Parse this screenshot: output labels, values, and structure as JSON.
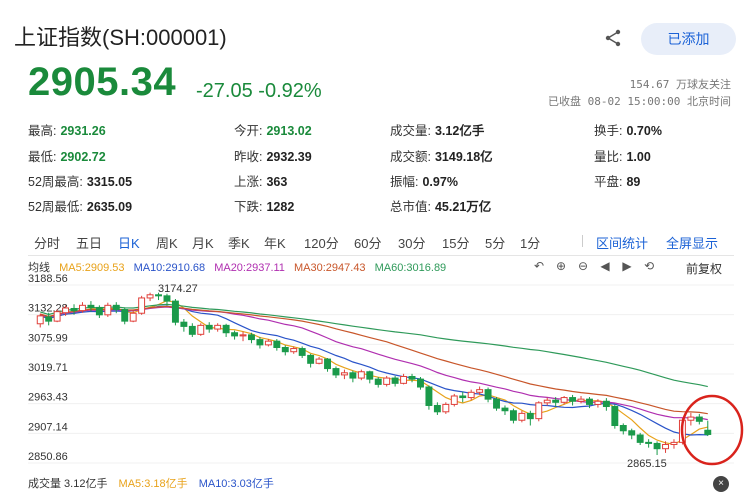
{
  "header": {
    "title": "上证指数(SH:000001)",
    "add_label": "已添加",
    "share_icon": "share-icon"
  },
  "price": {
    "current": "2905.34",
    "change": "-27.05",
    "change_pct": "-0.92%",
    "followers": "154.67 万球友关注",
    "status": "已收盘 08-02 15:00:00 北京时间"
  },
  "quotes": {
    "high_label": "最高:",
    "high": "2931.26",
    "low_label": "最低:",
    "low": "2902.72",
    "wk52_high_label": "52周最高:",
    "wk52_high": "3315.05",
    "wk52_low_label": "52周最低:",
    "wk52_low": "2635.09",
    "open_label": "今开:",
    "open": "2913.02",
    "prev_close_label": "昨收:",
    "prev_close": "2932.39",
    "up_label": "上涨:",
    "up": "363",
    "down_label": "下跌:",
    "down": "1282",
    "volume_label": "成交量:",
    "volume": "3.12亿手",
    "turnover_label": "成交额:",
    "turnover": "3149.18亿",
    "amplitude_label": "振幅:",
    "amplitude": "0.97%",
    "mcap_label": "总市值:",
    "mcap": "45.21万亿",
    "turnover_rate_label": "换手:",
    "turnover_rate": "0.70%",
    "vol_ratio_label": "量比:",
    "vol_ratio": "1.00",
    "flat_label": "平盘:",
    "flat": "89"
  },
  "tabs": {
    "items": [
      "分时",
      "五日",
      "日K",
      "周K",
      "月K",
      "季K",
      "年K",
      "120分",
      "60分",
      "30分",
      "15分",
      "5分",
      "1分"
    ],
    "active": "日K",
    "interval_stats": "区间统计",
    "fullscreen": "全屏显示"
  },
  "ma": {
    "label": "均线",
    "ma5": "MA5:2909.53",
    "ma10": "MA10:2910.68",
    "ma20": "MA20:2937.11",
    "ma30": "MA30:2947.43",
    "ma60": "MA60:3016.89",
    "adjust": "前复权",
    "colors": {
      "ma5": "#e8a21a",
      "ma10": "#2a54c9",
      "ma20": "#b02fb0",
      "ma30": "#c8562a",
      "ma60": "#2f9a5a"
    }
  },
  "chart_icons": [
    "undo-icon",
    "zoom-in-icon",
    "zoom-out-icon",
    "prev-icon",
    "next-icon",
    "reset-icon"
  ],
  "chart_data": {
    "type": "candlestick",
    "y_ticks": [
      "3188.56",
      "3132.28",
      "3075.99",
      "3019.71",
      "2963.43",
      "2907.14",
      "2850.86"
    ],
    "ylim": [
      2850.86,
      3188.56
    ],
    "max_label": "3174.27",
    "min_label": "2865.15",
    "candles": [
      [
        3115,
        3130,
        3108,
        3134
      ],
      [
        3128,
        3120,
        3112,
        3136
      ],
      [
        3120,
        3138,
        3118,
        3142
      ],
      [
        3136,
        3145,
        3130,
        3150
      ],
      [
        3144,
        3140,
        3132,
        3152
      ],
      [
        3140,
        3150,
        3136,
        3156
      ],
      [
        3150,
        3146,
        3138,
        3158
      ],
      [
        3146,
        3132,
        3126,
        3150
      ],
      [
        3132,
        3150,
        3128,
        3155
      ],
      [
        3150,
        3142,
        3135,
        3156
      ],
      [
        3142,
        3120,
        3114,
        3146
      ],
      [
        3120,
        3135,
        3118,
        3140
      ],
      [
        3135,
        3164,
        3132,
        3168
      ],
      [
        3164,
        3170,
        3158,
        3174
      ],
      [
        3170,
        3168,
        3160,
        3174
      ],
      [
        3168,
        3158,
        3150,
        3172
      ],
      [
        3158,
        3118,
        3112,
        3162
      ],
      [
        3118,
        3110,
        3100,
        3124
      ],
      [
        3110,
        3095,
        3090,
        3116
      ],
      [
        3095,
        3112,
        3092,
        3116
      ],
      [
        3112,
        3105,
        3098,
        3118
      ],
      [
        3105,
        3112,
        3100,
        3116
      ],
      [
        3112,
        3098,
        3090,
        3115
      ],
      [
        3098,
        3092,
        3085,
        3102
      ],
      [
        3092,
        3094,
        3082,
        3100
      ],
      [
        3094,
        3085,
        3078,
        3098
      ],
      [
        3085,
        3075,
        3068,
        3090
      ],
      [
        3075,
        3082,
        3072,
        3086
      ],
      [
        3082,
        3070,
        3064,
        3086
      ],
      [
        3070,
        3062,
        3055,
        3074
      ],
      [
        3062,
        3068,
        3058,
        3072
      ],
      [
        3068,
        3055,
        3050,
        3072
      ],
      [
        3055,
        3040,
        3032,
        3058
      ],
      [
        3040,
        3048,
        3038,
        3052
      ],
      [
        3048,
        3030,
        3024,
        3050
      ],
      [
        3030,
        3018,
        3012,
        3034
      ],
      [
        3018,
        3022,
        3010,
        3028
      ],
      [
        3022,
        3012,
        3004,
        3026
      ],
      [
        3012,
        3024,
        3008,
        3028
      ],
      [
        3024,
        3010,
        3002,
        3026
      ],
      [
        3010,
        3000,
        2994,
        3014
      ],
      [
        3000,
        3012,
        2996,
        3016
      ],
      [
        3012,
        3002,
        2996,
        3016
      ],
      [
        3002,
        3015,
        3000,
        3020
      ],
      [
        3015,
        3010,
        3004,
        3020
      ],
      [
        3010,
        2995,
        2990,
        3014
      ],
      [
        2995,
        2960,
        2952,
        2998
      ],
      [
        2960,
        2948,
        2942,
        2966
      ],
      [
        2948,
        2962,
        2944,
        2966
      ],
      [
        2962,
        2978,
        2958,
        2982
      ],
      [
        2978,
        2975,
        2966,
        2986
      ],
      [
        2975,
        2985,
        2970,
        2990
      ],
      [
        2985,
        2990,
        2980,
        2996
      ],
      [
        2990,
        2972,
        2966,
        2994
      ],
      [
        2972,
        2955,
        2950,
        2976
      ],
      [
        2955,
        2950,
        2942,
        2960
      ],
      [
        2950,
        2932,
        2926,
        2954
      ],
      [
        2932,
        2945,
        2928,
        2950
      ],
      [
        2945,
        2935,
        2922,
        2950
      ],
      [
        2935,
        2965,
        2930,
        2968
      ],
      [
        2965,
        2970,
        2960,
        2975
      ],
      [
        2970,
        2966,
        2958,
        2976
      ],
      [
        2966,
        2975,
        2962,
        2978
      ],
      [
        2975,
        2968,
        2960,
        2980
      ],
      [
        2968,
        2972,
        2964,
        2978
      ],
      [
        2972,
        2962,
        2955,
        2976
      ],
      [
        2962,
        2968,
        2956,
        2972
      ],
      [
        2968,
        2958,
        2950,
        2974
      ],
      [
        2958,
        2922,
        2916,
        2962
      ],
      [
        2922,
        2912,
        2905,
        2926
      ],
      [
        2912,
        2904,
        2896,
        2916
      ],
      [
        2904,
        2890,
        2885,
        2908
      ],
      [
        2890,
        2888,
        2880,
        2896
      ],
      [
        2888,
        2878,
        2866,
        2892
      ],
      [
        2878,
        2886,
        2870,
        2892
      ],
      [
        2886,
        2890,
        2878,
        2896
      ],
      [
        2890,
        2932,
        2886,
        2936
      ],
      [
        2932,
        2938,
        2922,
        2946
      ],
      [
        2938,
        2930,
        2924,
        2944
      ],
      [
        2913,
        2905,
        2902,
        2931
      ]
    ]
  },
  "volume": {
    "label": "成交量 3.12亿手",
    "ma5": "MA5:3.18亿手",
    "ma10": "MA10:3.03亿手",
    "close_icon": "close-icon"
  }
}
